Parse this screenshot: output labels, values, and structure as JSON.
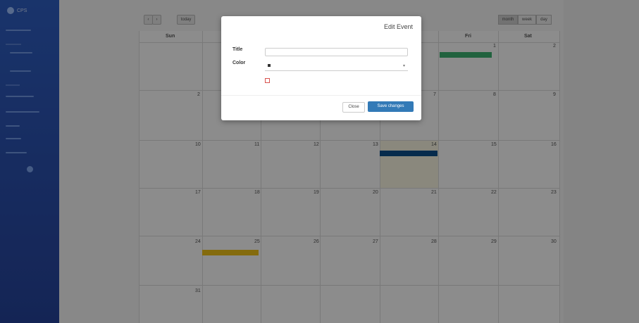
{
  "sidebar": {
    "brand": "CPS"
  },
  "toolbar": {
    "prev": "‹",
    "next": "›",
    "today": "today",
    "title": "",
    "views": [
      "month",
      "week",
      "day"
    ]
  },
  "calendar": {
    "days_of_week": [
      "Sun",
      "",
      "",
      "",
      "",
      "Fri",
      "Sat"
    ],
    "rows": [
      [
        "",
        "",
        "",
        "",
        "",
        "1",
        "2"
      ],
      [
        "2",
        "",
        "",
        "",
        "7",
        "8",
        "9"
      ],
      [
        "10",
        "11",
        "12",
        "13",
        "14",
        "15",
        "16"
      ],
      [
        "17",
        "18",
        "19",
        "20",
        "21",
        "22",
        "23"
      ],
      [
        "24",
        "25",
        "26",
        "27",
        "28",
        "29",
        "30"
      ],
      [
        "31",
        "",
        "",
        "",
        "",
        "",
        ""
      ]
    ],
    "events": [
      {
        "label": "",
        "color": "#3cb371"
      },
      {
        "label": "",
        "color": "#0b4f8a"
      },
      {
        "label": "",
        "color": "#f0c419"
      }
    ]
  },
  "modal": {
    "title": "Edit Event",
    "title_label": "Title",
    "title_value": "",
    "color_label": "Color",
    "color_value": "",
    "delete_label": "",
    "close_label": "Close",
    "save_label": "Save changes"
  }
}
